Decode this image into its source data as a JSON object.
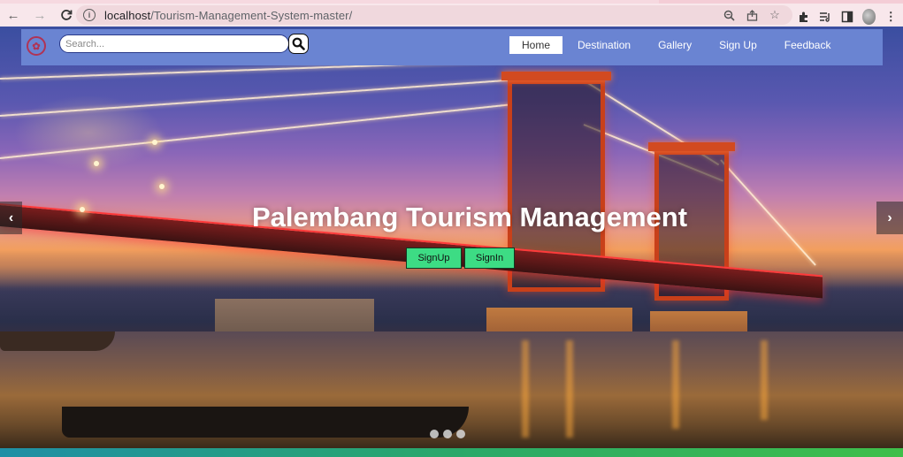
{
  "browser": {
    "url_host": "localhost",
    "url_path": "/Tourism-Management-System-master/"
  },
  "site": {
    "search_placeholder": "Search...",
    "nav": [
      {
        "label": "Home",
        "active": true
      },
      {
        "label": "Destination",
        "active": false
      },
      {
        "label": "Gallery",
        "active": false
      },
      {
        "label": "Sign Up",
        "active": false
      },
      {
        "label": "Feedback",
        "active": false
      }
    ]
  },
  "hero": {
    "title": "Palembang Tourism Management",
    "signup_label": "SignUp",
    "signin_label": "SignIn",
    "prev_glyph": "‹",
    "next_glyph": "›"
  },
  "colors": {
    "navbar": "#6a84d2",
    "cta": "#3ddc84",
    "browser_toolbar": "#f8e7eb"
  },
  "icons": [
    "back-arrow-icon",
    "forward-arrow-icon",
    "reload-icon",
    "info-icon",
    "zoom-icon",
    "share-icon",
    "star-icon",
    "extensions-icon",
    "media-icon",
    "sidepanel-icon",
    "avatar-icon",
    "menu-dots-icon",
    "search-icon",
    "logo-icon"
  ]
}
